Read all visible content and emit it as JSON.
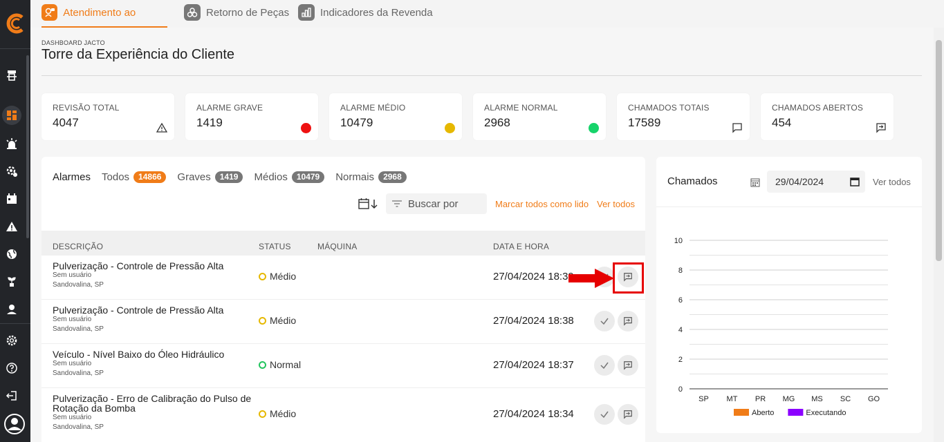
{
  "tabs": [
    {
      "label": "Atendimento ao Cliente",
      "active": true,
      "icon": "customer-service-icon"
    },
    {
      "label": "Retorno de Peças",
      "active": false,
      "icon": "parts-return-icon"
    },
    {
      "label": "Indicadores da Revenda",
      "active": false,
      "icon": "bar-chart-icon"
    }
  ],
  "header": {
    "breadcrumb": "DASHBOARD JACTO",
    "title": "Torre da Experiência do Cliente"
  },
  "cards": [
    {
      "label": "REVISÃO TOTAL",
      "value": "4047",
      "icon": "warning-icon"
    },
    {
      "label": "ALARME GRAVE",
      "value": "1419",
      "color": "#ee1111"
    },
    {
      "label": "ALARME MÉDIO",
      "value": "10479",
      "color": "#e6b800"
    },
    {
      "label": "ALARME NORMAL",
      "value": "2968",
      "color": "#16d36a"
    },
    {
      "label": "CHAMADOS TOTAIS",
      "value": "17589",
      "icon": "chat-icon"
    },
    {
      "label": "CHAMADOS ABERTOS",
      "value": "454",
      "icon": "open-ticket-icon"
    }
  ],
  "alarms": {
    "title": "Alarmes",
    "filters": [
      {
        "label": "Todos",
        "count": "14866"
      },
      {
        "label": "Graves",
        "count": "1419"
      },
      {
        "label": "Médios",
        "count": "10479"
      },
      {
        "label": "Normais",
        "count": "2968"
      }
    ],
    "search_placeholder": "Buscar por",
    "mark_all_read": "Marcar todos como lido",
    "see_all": "Ver todos",
    "columns": {
      "description": "DESCRIÇÃO",
      "status": "STATUS",
      "machine": "MÁQUINA",
      "datetime": "DATA E HORA"
    },
    "rows": [
      {
        "title": "Pulverização - Controle de Pressão Alta",
        "user": "Sem usuário",
        "location": "Sandovalina, SP",
        "status": "Médio",
        "datetime": "27/04/2024 18:39"
      },
      {
        "title": "Pulverização - Controle de Pressão Alta",
        "user": "Sem usuário",
        "location": "Sandovalina, SP",
        "status": "Médio",
        "datetime": "27/04/2024 18:38"
      },
      {
        "title": "Veículo - Nível Baixo do Óleo Hidráulico",
        "user": "Sem usuário",
        "location": "Sandovalina, SP",
        "status": "Normal",
        "datetime": "27/04/2024 18:37"
      },
      {
        "title": "Pulverização - Erro de Calibração do Pulso de Rotação da Bomba",
        "user": "Sem usuário",
        "location": "Sandovalina, SP",
        "status": "Médio",
        "datetime": "27/04/2024 18:34"
      }
    ]
  },
  "chamados": {
    "title": "Chamados",
    "date": "29/04/2024",
    "see_all": "Ver todos"
  },
  "chart_data": {
    "type": "bar",
    "categories": [
      "SP",
      "MT",
      "PR",
      "MG",
      "MS",
      "SC",
      "GO"
    ],
    "series": [
      {
        "name": "Aberto",
        "color": "#f07c18",
        "values": [
          0,
          0,
          0,
          0,
          0,
          0,
          0
        ]
      },
      {
        "name": "Executando",
        "color": "#8b00ff",
        "values": [
          0,
          0,
          0,
          0,
          0,
          0,
          0
        ]
      }
    ],
    "yticks": [
      0,
      2,
      4,
      6,
      8,
      10
    ],
    "ylim": [
      0,
      10
    ],
    "grid": true,
    "legend": "bottom"
  }
}
